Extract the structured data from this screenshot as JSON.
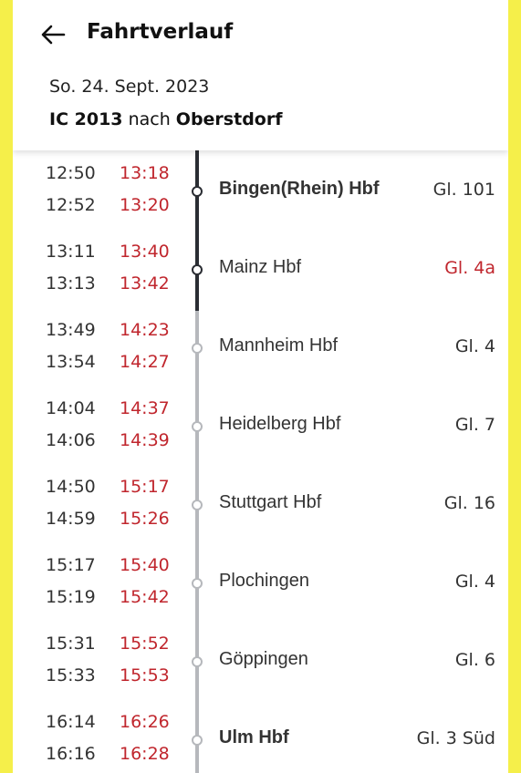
{
  "header": {
    "title": "Fahrtverlauf",
    "date": "So. 24. Sept. 2023",
    "train": "IC 2013",
    "connector": "nach",
    "destination": "Oberstdorf"
  },
  "stops": [
    {
      "arr_sched": "12:50",
      "arr_rt": "13:18",
      "dep_sched": "12:52",
      "dep_rt": "13:20",
      "station": "Bingen(Rhein) Hbf",
      "platform": "Gl. 101",
      "bold": true,
      "platform_changed": false,
      "passed": true
    },
    {
      "arr_sched": "13:11",
      "arr_rt": "13:40",
      "dep_sched": "13:13",
      "dep_rt": "13:42",
      "station": "Mainz Hbf",
      "platform": "Gl. 4a",
      "bold": false,
      "platform_changed": true,
      "passed": true
    },
    {
      "arr_sched": "13:49",
      "arr_rt": "14:23",
      "dep_sched": "13:54",
      "dep_rt": "14:27",
      "station": "Mannheim Hbf",
      "platform": "Gl. 4",
      "bold": false,
      "platform_changed": false,
      "passed": false
    },
    {
      "arr_sched": "14:04",
      "arr_rt": "14:37",
      "dep_sched": "14:06",
      "dep_rt": "14:39",
      "station": "Heidelberg Hbf",
      "platform": "Gl. 7",
      "bold": false,
      "platform_changed": false,
      "passed": false
    },
    {
      "arr_sched": "14:50",
      "arr_rt": "15:17",
      "dep_sched": "14:59",
      "dep_rt": "15:26",
      "station": "Stuttgart Hbf",
      "platform": "Gl. 16",
      "bold": false,
      "platform_changed": false,
      "passed": false
    },
    {
      "arr_sched": "15:17",
      "arr_rt": "15:40",
      "dep_sched": "15:19",
      "dep_rt": "15:42",
      "station": "Plochingen",
      "platform": "Gl. 4",
      "bold": false,
      "platform_changed": false,
      "passed": false
    },
    {
      "arr_sched": "15:31",
      "arr_rt": "15:52",
      "dep_sched": "15:33",
      "dep_rt": "15:53",
      "station": "Göppingen",
      "platform": "Gl. 6",
      "bold": false,
      "platform_changed": false,
      "passed": false
    },
    {
      "arr_sched": "16:14",
      "arr_rt": "16:26",
      "dep_sched": "16:16",
      "dep_rt": "16:28",
      "station": "Ulm Hbf",
      "platform": "Gl. 3 Süd",
      "bold": true,
      "platform_changed": false,
      "passed": false
    }
  ],
  "colors": {
    "page_background": "#f5ef4a",
    "delay": "#c0262d",
    "passed_line": "#2a2d33",
    "future_line": "#b6b8bc"
  }
}
